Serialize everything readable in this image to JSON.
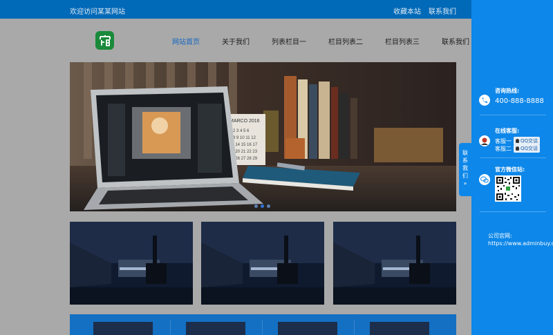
{
  "topbar": {
    "welcome": "欢迎访问某某网站",
    "favorite": "收藏本站",
    "contact": "联系我们"
  },
  "logo": {
    "icon": "logo-icon"
  },
  "nav": {
    "items": [
      "网站首页",
      "关于我们",
      "列表栏目一",
      "栏目列表二",
      "栏目列表三",
      "联系我们"
    ],
    "active_index": 0
  },
  "banner": {
    "calendar_text": "MARCO 2016",
    "slide_count": 3,
    "active_slide": 2
  },
  "sidebar_tab": {
    "label": [
      "联",
      "系",
      "我",
      "们"
    ],
    "arrow": "»"
  },
  "sidepanel": {
    "hotline_label": "咨询热线:",
    "phone": "400-888-8888",
    "service_label": "在线客服:",
    "agents": [
      {
        "name": "客服一",
        "button": "QQ交谈"
      },
      {
        "name": "客服二",
        "button": "QQ交谈"
      }
    ],
    "wechat_label": "官方微信站:",
    "site_label": "公司官网:",
    "site_url": "https://www.adminbuy.cn"
  },
  "colors": {
    "topbar": "#0069b8",
    "accent": "#1366c0",
    "panel": "#0d87e9",
    "overlay": "#a9a9a9"
  }
}
